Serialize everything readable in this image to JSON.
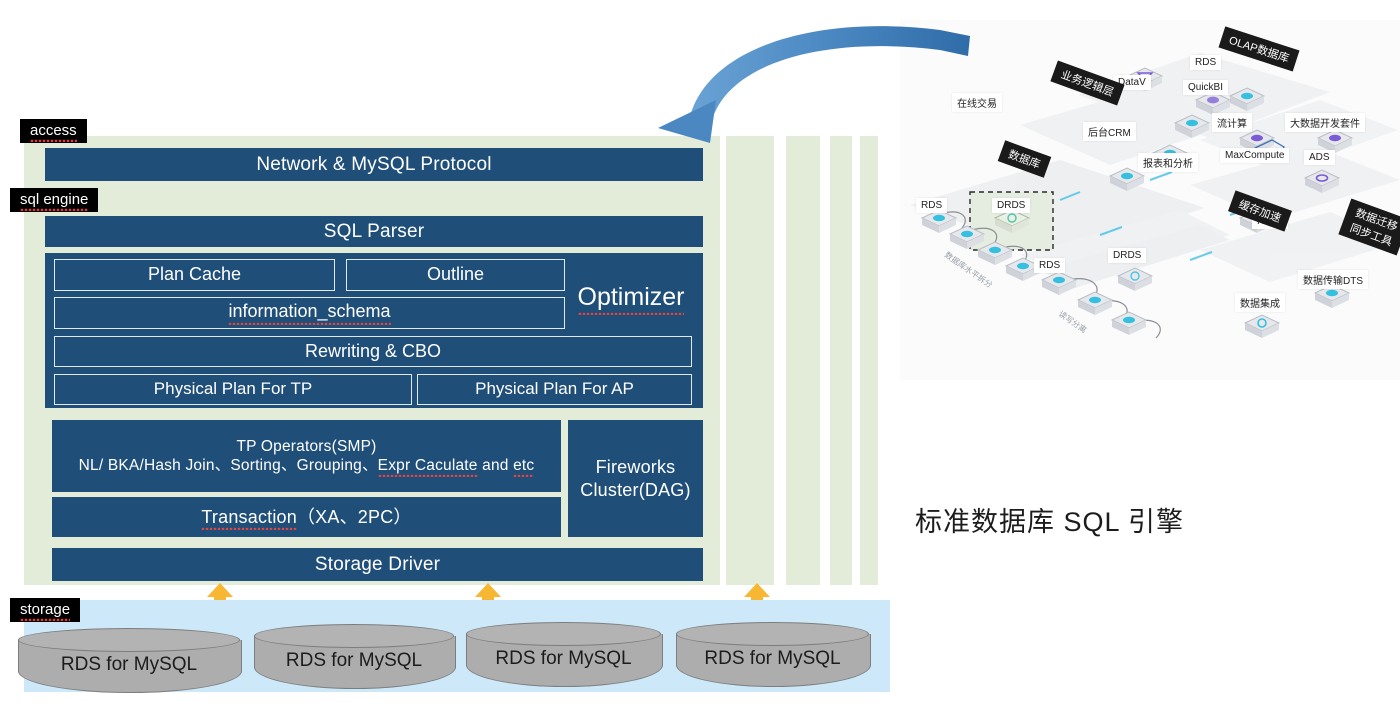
{
  "slide": {
    "caption": "标准数据库 SQL 引擎",
    "colors": {
      "blue_box": "#1f4e79",
      "green_panel": "#e3ecd9",
      "storage_band": "#cde9f9",
      "cylinder": "#adadad",
      "arrow_blue": "#4a86c5",
      "arrow_orange": "#f7b733",
      "tag_black": "#000000"
    }
  },
  "layers": {
    "access": {
      "tag": "access",
      "boxes": [
        {
          "label": "Network & MySQL Protocol"
        }
      ]
    },
    "sql_engine": {
      "tag": "sql engine",
      "parser": {
        "label": "SQL Parser"
      },
      "optimizer": {
        "title": "Optimizer",
        "boxes": [
          {
            "label": "Plan Cache"
          },
          {
            "label": "Outline"
          },
          {
            "label": "information_schema"
          },
          {
            "label": "Rewriting & CBO"
          },
          {
            "label": "Physical Plan For TP"
          },
          {
            "label": "Physical Plan For AP"
          }
        ]
      },
      "execution": {
        "tp_operators_line1": "TP Operators(SMP)",
        "tp_operators_line2_a": "NL/ BKA/Hash Join、Sorting、Grouping、",
        "tp_operators_line2_b": "Expr Caculate",
        "tp_operators_line2_c": " and ",
        "tp_operators_line2_d": "etc",
        "transaction_a": "Transaction",
        "transaction_b": "（XA、2PC）",
        "fireworks_line1": "Fireworks",
        "fireworks_line2": "Cluster(DAG)",
        "storage_driver": "Storage Driver"
      }
    },
    "storage": {
      "tag": "storage",
      "databases": [
        {
          "label": "RDS for MySQL"
        },
        {
          "label": "RDS for MySQL"
        },
        {
          "label": "RDS for MySQL"
        },
        {
          "label": "RDS for MySQL"
        }
      ]
    }
  },
  "architecture": {
    "zone_labels": [
      {
        "text": "数据库"
      },
      {
        "text": "业务逻辑层"
      },
      {
        "text": "OLAP数据库"
      },
      {
        "text": "缓存加速"
      },
      {
        "text": "数据迁移\n同步工具"
      }
    ],
    "zone_labels_flat": {
      "database": "数据库",
      "business_logic": "业务逻辑层",
      "olap": "OLAP数据库",
      "cache": "缓存加速",
      "migration": "数据迁移 同步工具"
    },
    "nodes": [
      {
        "text": "DataV"
      },
      {
        "text": "RDS"
      },
      {
        "text": "QuickBI"
      },
      {
        "text": "在线交易"
      },
      {
        "text": "后台CRM"
      },
      {
        "text": "报表和分析"
      },
      {
        "text": "流计算"
      },
      {
        "text": "大数据开发套件"
      },
      {
        "text": "MaxCompute"
      },
      {
        "text": "ADS"
      },
      {
        "text": "Redis"
      },
      {
        "text": "数据传输DTS"
      },
      {
        "text": "数据集成"
      },
      {
        "text": "DRDS"
      },
      {
        "text": "RDS"
      },
      {
        "text": "RDS"
      },
      {
        "text": "DRDS"
      }
    ],
    "vertical_texts": {
      "shard_1": "数据库水平拆分",
      "shard_2": "读写分离"
    }
  }
}
